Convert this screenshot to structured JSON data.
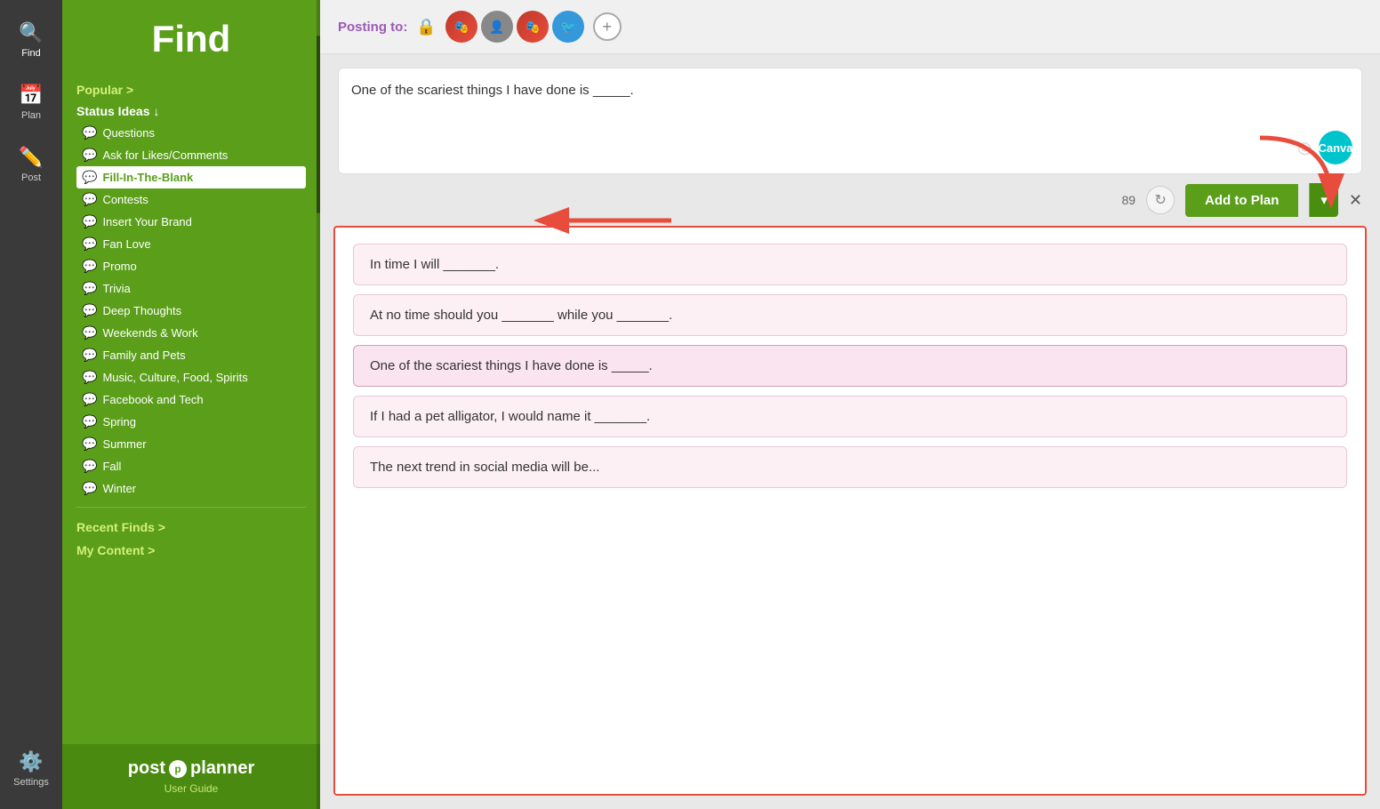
{
  "app": {
    "title": "Find"
  },
  "icon_bar": {
    "items": [
      {
        "id": "find",
        "label": "Find",
        "icon": "🔍",
        "active": true
      },
      {
        "id": "plan",
        "label": "Plan",
        "icon": "📅",
        "active": false
      },
      {
        "id": "post",
        "label": "Post",
        "icon": "✏️",
        "active": false
      },
      {
        "id": "settings",
        "label": "Settings",
        "icon": "⚙️",
        "active": false
      }
    ]
  },
  "sidebar": {
    "title": "Find",
    "popular_label": "Popular >",
    "status_ideas_label": "Status Ideas ↓",
    "items": [
      {
        "id": "questions",
        "label": "Questions",
        "active": false
      },
      {
        "id": "ask-likes",
        "label": "Ask for Likes/Comments",
        "active": false
      },
      {
        "id": "fill-in-blank",
        "label": "Fill-In-The-Blank",
        "active": true
      },
      {
        "id": "contests",
        "label": "Contests",
        "active": false
      },
      {
        "id": "insert-brand",
        "label": "Insert Your Brand",
        "active": false
      },
      {
        "id": "fan-love",
        "label": "Fan Love",
        "active": false
      },
      {
        "id": "promo",
        "label": "Promo",
        "active": false
      },
      {
        "id": "trivia",
        "label": "Trivia",
        "active": false
      },
      {
        "id": "deep-thoughts",
        "label": "Deep Thoughts",
        "active": false
      },
      {
        "id": "weekends-work",
        "label": "Weekends & Work",
        "active": false
      },
      {
        "id": "family-pets",
        "label": "Family and Pets",
        "active": false
      },
      {
        "id": "music-culture",
        "label": "Music, Culture, Food, Spirits",
        "active": false
      },
      {
        "id": "facebook-tech",
        "label": "Facebook and Tech",
        "active": false
      },
      {
        "id": "spring",
        "label": "Spring",
        "active": false
      },
      {
        "id": "summer",
        "label": "Summer",
        "active": false
      },
      {
        "id": "fall",
        "label": "Fall",
        "active": false
      },
      {
        "id": "winter",
        "label": "Winter",
        "active": false
      }
    ],
    "recent_finds_label": "Recent Finds >",
    "my_content_label": "My Content >",
    "logo_text": "post🅟planner",
    "user_guide_label": "User Guide"
  },
  "posting_bar": {
    "label": "Posting to:",
    "add_btn": "+"
  },
  "editor": {
    "text": "One of the scariest things I have done is _____.",
    "char_count": "89",
    "canva_label": "Canva",
    "add_to_plan_label": "Add to Plan",
    "dropdown_symbol": "▾",
    "close_symbol": "✕"
  },
  "content_items": [
    {
      "id": 1,
      "text": "In time I will _______."
    },
    {
      "id": 2,
      "text": "At no time should you _______ while you _______."
    },
    {
      "id": 3,
      "text": "One of the scariest things I have done is _____."
    },
    {
      "id": 4,
      "text": "If I had a pet alligator, I would name it _______."
    },
    {
      "id": 5,
      "text": "The next trend in social media will be..."
    }
  ],
  "colors": {
    "green": "#5a9e1a",
    "dark_green": "#4a8e10",
    "red_arrow": "#e74c3c",
    "purple": "#9b59b6"
  }
}
